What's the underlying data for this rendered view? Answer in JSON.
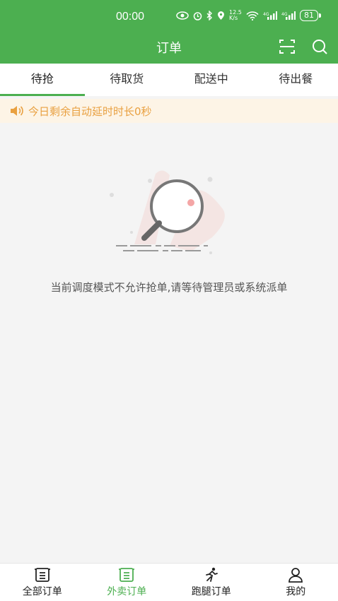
{
  "status_bar": {
    "time": "00:00",
    "net_speed": "12.5 K/s",
    "battery": "81"
  },
  "header": {
    "title": "订单",
    "scan_icon": "scan-icon",
    "search_icon": "search-icon"
  },
  "tabs": [
    {
      "label": "待抢",
      "active": true
    },
    {
      "label": "待取货",
      "active": false
    },
    {
      "label": "配送中",
      "active": false
    },
    {
      "label": "待出餐",
      "active": false
    }
  ],
  "notice": {
    "icon": "speaker-icon",
    "text": "今日剩余自动延时时长0秒"
  },
  "empty_state": {
    "icon": "magnifier-empty-illustration",
    "message": "当前调度模式不允许抢单,请等待管理员或系统派单"
  },
  "bottom_nav": [
    {
      "label": "全部订单",
      "icon": "list-icon",
      "active": false
    },
    {
      "label": "外卖订单",
      "icon": "list-icon",
      "active": true
    },
    {
      "label": "跑腿订单",
      "icon": "runner-icon",
      "active": false
    },
    {
      "label": "我的",
      "icon": "user-icon",
      "active": false
    }
  ],
  "colors": {
    "primary": "#4caf50",
    "notice_bg": "#fdf4e6",
    "notice_text": "#e9a040"
  }
}
